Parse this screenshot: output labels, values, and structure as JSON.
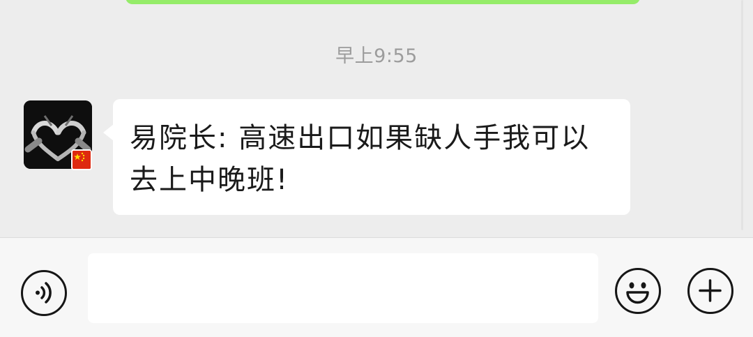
{
  "chat": {
    "timestamp": "早上9:55",
    "message": {
      "sender": "易院长",
      "separator": ":",
      "text": "高速出口如果缺人手我可以去上中晚班!",
      "full_text": "易院长: 高速出口如果缺人手我可以去上中晚班!"
    }
  },
  "input_bar": {
    "input_value": "",
    "icons": {
      "voice": "voice-icon",
      "emoji": "emoji-icon",
      "more": "plus-icon"
    }
  },
  "colors": {
    "background": "#ededed",
    "sent_bubble": "#95ec69",
    "received_bubble": "#ffffff",
    "timestamp_text": "#9c9c9c"
  }
}
